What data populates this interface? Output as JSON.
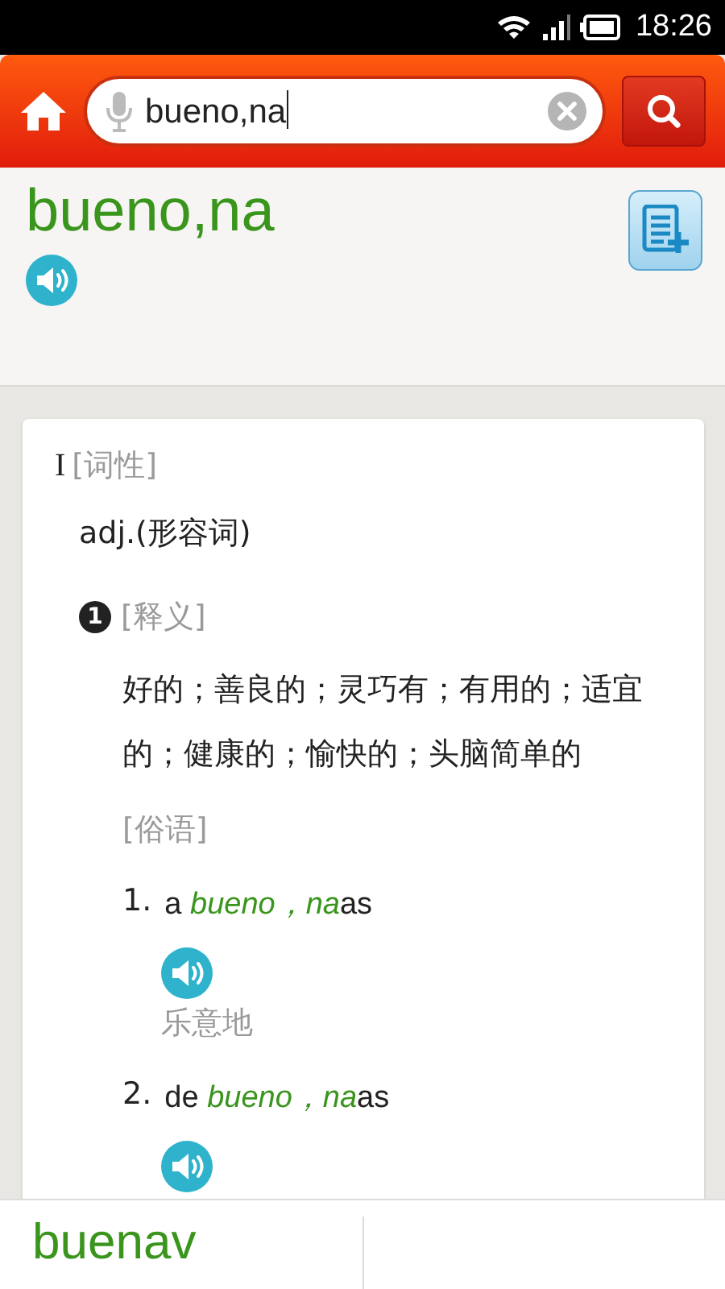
{
  "status_bar": {
    "time": "18:26"
  },
  "search": {
    "value": "bueno,na"
  },
  "entry": {
    "headword": "bueno,na"
  },
  "sections": [
    {
      "numeral": "I",
      "label": "[词性]",
      "pos": "adj.(形容词)",
      "senses": [
        {
          "number": "1",
          "label": "[释义]",
          "definition": "好的；善良的；灵巧有；有用的；适宜的；健康的；愉快的；头脑简单的",
          "idioms_label": "[俗语]",
          "idioms": [
            {
              "number": "1.",
              "prefix": "a",
              "word": "bueno，na",
              "suffix": "as",
              "translation": "乐意地"
            },
            {
              "number": "2.",
              "prefix": "de",
              "word": "bueno，na",
              "suffix": "as"
            }
          ]
        }
      ]
    }
  ],
  "bottom_bar": {
    "items": [
      "buenav"
    ]
  }
}
